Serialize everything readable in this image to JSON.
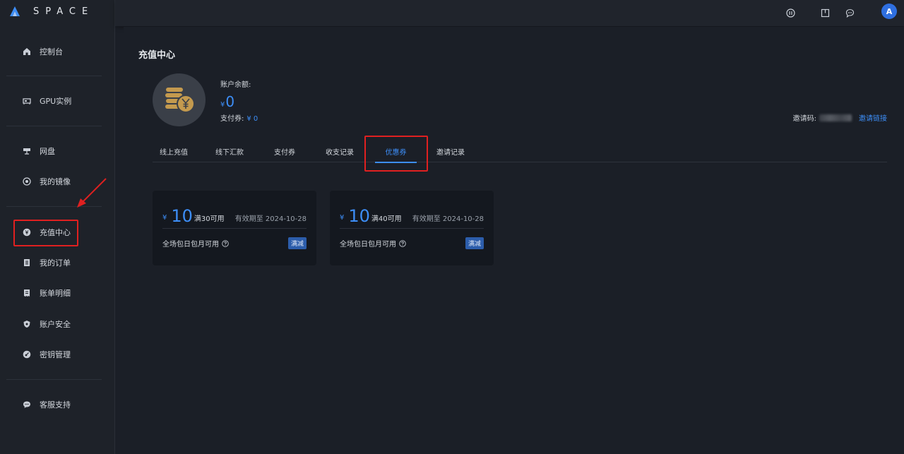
{
  "app": {
    "name": "SPACE",
    "avatar_initial": "A"
  },
  "sidebar": {
    "items": [
      {
        "label": "控制台",
        "icon": "home-icon"
      },
      {
        "label": "GPU实例",
        "icon": "gpu-icon"
      },
      {
        "label": "网盘",
        "icon": "storage-icon"
      },
      {
        "label": "我的镜像",
        "icon": "image-disc-icon"
      },
      {
        "label": "充值中心",
        "icon": "recharge-icon"
      },
      {
        "label": "我的订单",
        "icon": "order-icon"
      },
      {
        "label": "账单明细",
        "icon": "bill-icon"
      },
      {
        "label": "账户安全",
        "icon": "shield-icon"
      },
      {
        "label": "密钥管理",
        "icon": "key-icon"
      },
      {
        "label": "客服支持",
        "icon": "chat-support-icon"
      }
    ]
  },
  "topbar": {
    "icons": [
      "info-icon",
      "book-icon",
      "message-icon"
    ]
  },
  "page": {
    "title": "充值中心",
    "balance_label": "账户余额:",
    "balance_currency": "¥",
    "balance_value": "0",
    "voucher_label": "支付券:",
    "voucher_value": "¥ 0",
    "invite_label": "邀请码:",
    "invite_link": "邀请链接"
  },
  "tabs": [
    {
      "label": "线上充值",
      "active": false
    },
    {
      "label": "线下汇款",
      "active": false
    },
    {
      "label": "支付券",
      "active": false
    },
    {
      "label": "收支记录",
      "active": false
    },
    {
      "label": "优惠券",
      "active": true
    },
    {
      "label": "邀请记录",
      "active": false
    }
  ],
  "coupons": [
    {
      "currency": "¥",
      "amount": "10",
      "condition": "满30可用",
      "expiry": "有效期至 2024-10-28",
      "scope": "全场包日包月可用",
      "tag": "满减"
    },
    {
      "currency": "¥",
      "amount": "10",
      "condition": "满40可用",
      "expiry": "有效期至 2024-10-28",
      "scope": "全场包日包月可用",
      "tag": "满减"
    }
  ],
  "colors": {
    "accent": "#3d8ef7",
    "highlight": "#e02020",
    "background": "#1b1f27"
  }
}
